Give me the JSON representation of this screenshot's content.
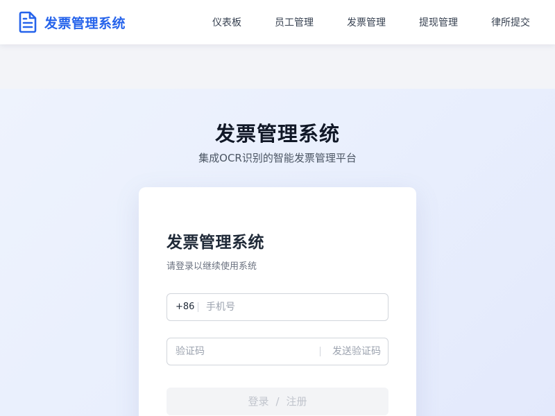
{
  "header": {
    "brand": {
      "icon": "document-icon",
      "title": "发票管理系统",
      "color": "#2563eb"
    },
    "nav": [
      {
        "label": "仪表板"
      },
      {
        "label": "员工管理"
      },
      {
        "label": "发票管理"
      },
      {
        "label": "提现管理"
      },
      {
        "label": "律所提交"
      }
    ]
  },
  "hero": {
    "title": "发票管理系统",
    "subtitle": "集成OCR识别的智能发票管理平台"
  },
  "login": {
    "title": "发票管理系统",
    "subtitle": "请登录以继续使用系统",
    "phone": {
      "prefix": "+86",
      "placeholder": "手机号",
      "value": ""
    },
    "code": {
      "placeholder": "验证码",
      "value": "",
      "send_label": "发送验证码"
    },
    "submit": {
      "login_label": "登录",
      "separator": "/",
      "register_label": "注册"
    }
  }
}
